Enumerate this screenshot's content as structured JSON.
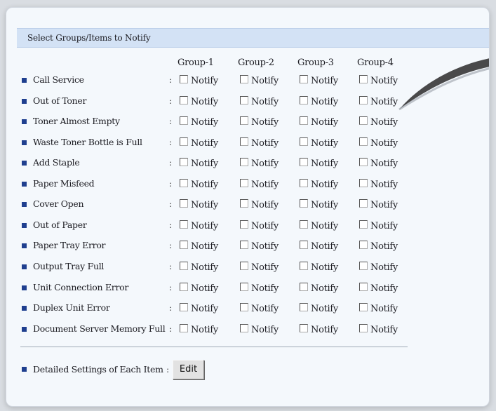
{
  "section_title": "Select Groups/Items to Notify",
  "groups": [
    "Group-1",
    "Group-2",
    "Group-3",
    "Group-4"
  ],
  "notify_label": "Notify",
  "colon": ":",
  "items": [
    {
      "label": "Call Service"
    },
    {
      "label": "Out of Toner"
    },
    {
      "label": "Toner Almost Empty"
    },
    {
      "label": "Waste Toner Bottle is Full"
    },
    {
      "label": "Add Staple"
    },
    {
      "label": "Paper Misfeed"
    },
    {
      "label": "Cover Open"
    },
    {
      "label": "Out of Paper"
    },
    {
      "label": "Paper Tray Error"
    },
    {
      "label": "Output Tray Full"
    },
    {
      "label": "Unit Connection Error"
    },
    {
      "label": "Duplex Unit Error"
    },
    {
      "label": "Document Server Memory Full"
    }
  ],
  "detailed_settings": {
    "label": "Detailed Settings of Each Item",
    "button_label": "Edit"
  },
  "colors": {
    "header_bg": "#d3e2f5",
    "bullet": "#1f3f8f",
    "panel_bg": "#f4f8fc"
  },
  "icons": {
    "bullet": "square-bullet-icon",
    "checkbox": "checkbox-unchecked-icon"
  }
}
